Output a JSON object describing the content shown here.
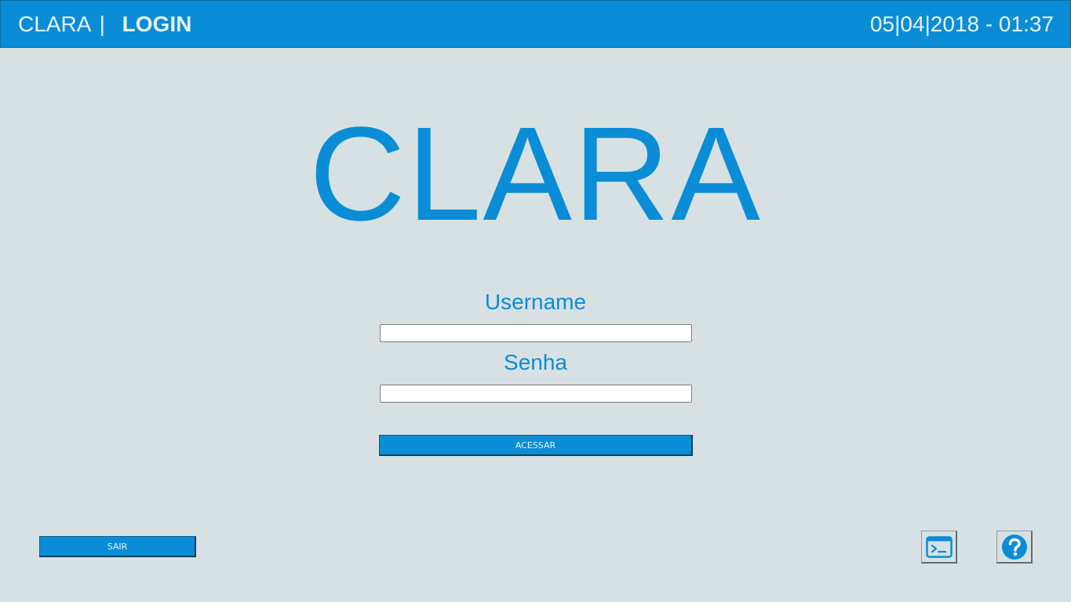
{
  "header": {
    "app_name": "CLARA",
    "separator": "|",
    "page_name": "LOGIN",
    "datetime": "05|04|2018 - 01:37"
  },
  "logo": {
    "text": "CLARA"
  },
  "form": {
    "username_label": "Username",
    "username_value": "",
    "password_label": "Senha",
    "password_value": "",
    "submit_label": "ACESSAR"
  },
  "footer": {
    "exit_label": "SAIR",
    "terminal_icon": "terminal-icon",
    "help_icon": "help-icon"
  },
  "colors": {
    "accent": "#0a8dd6",
    "background": "#d7e1e3",
    "header_text": "#e8f3fa"
  }
}
